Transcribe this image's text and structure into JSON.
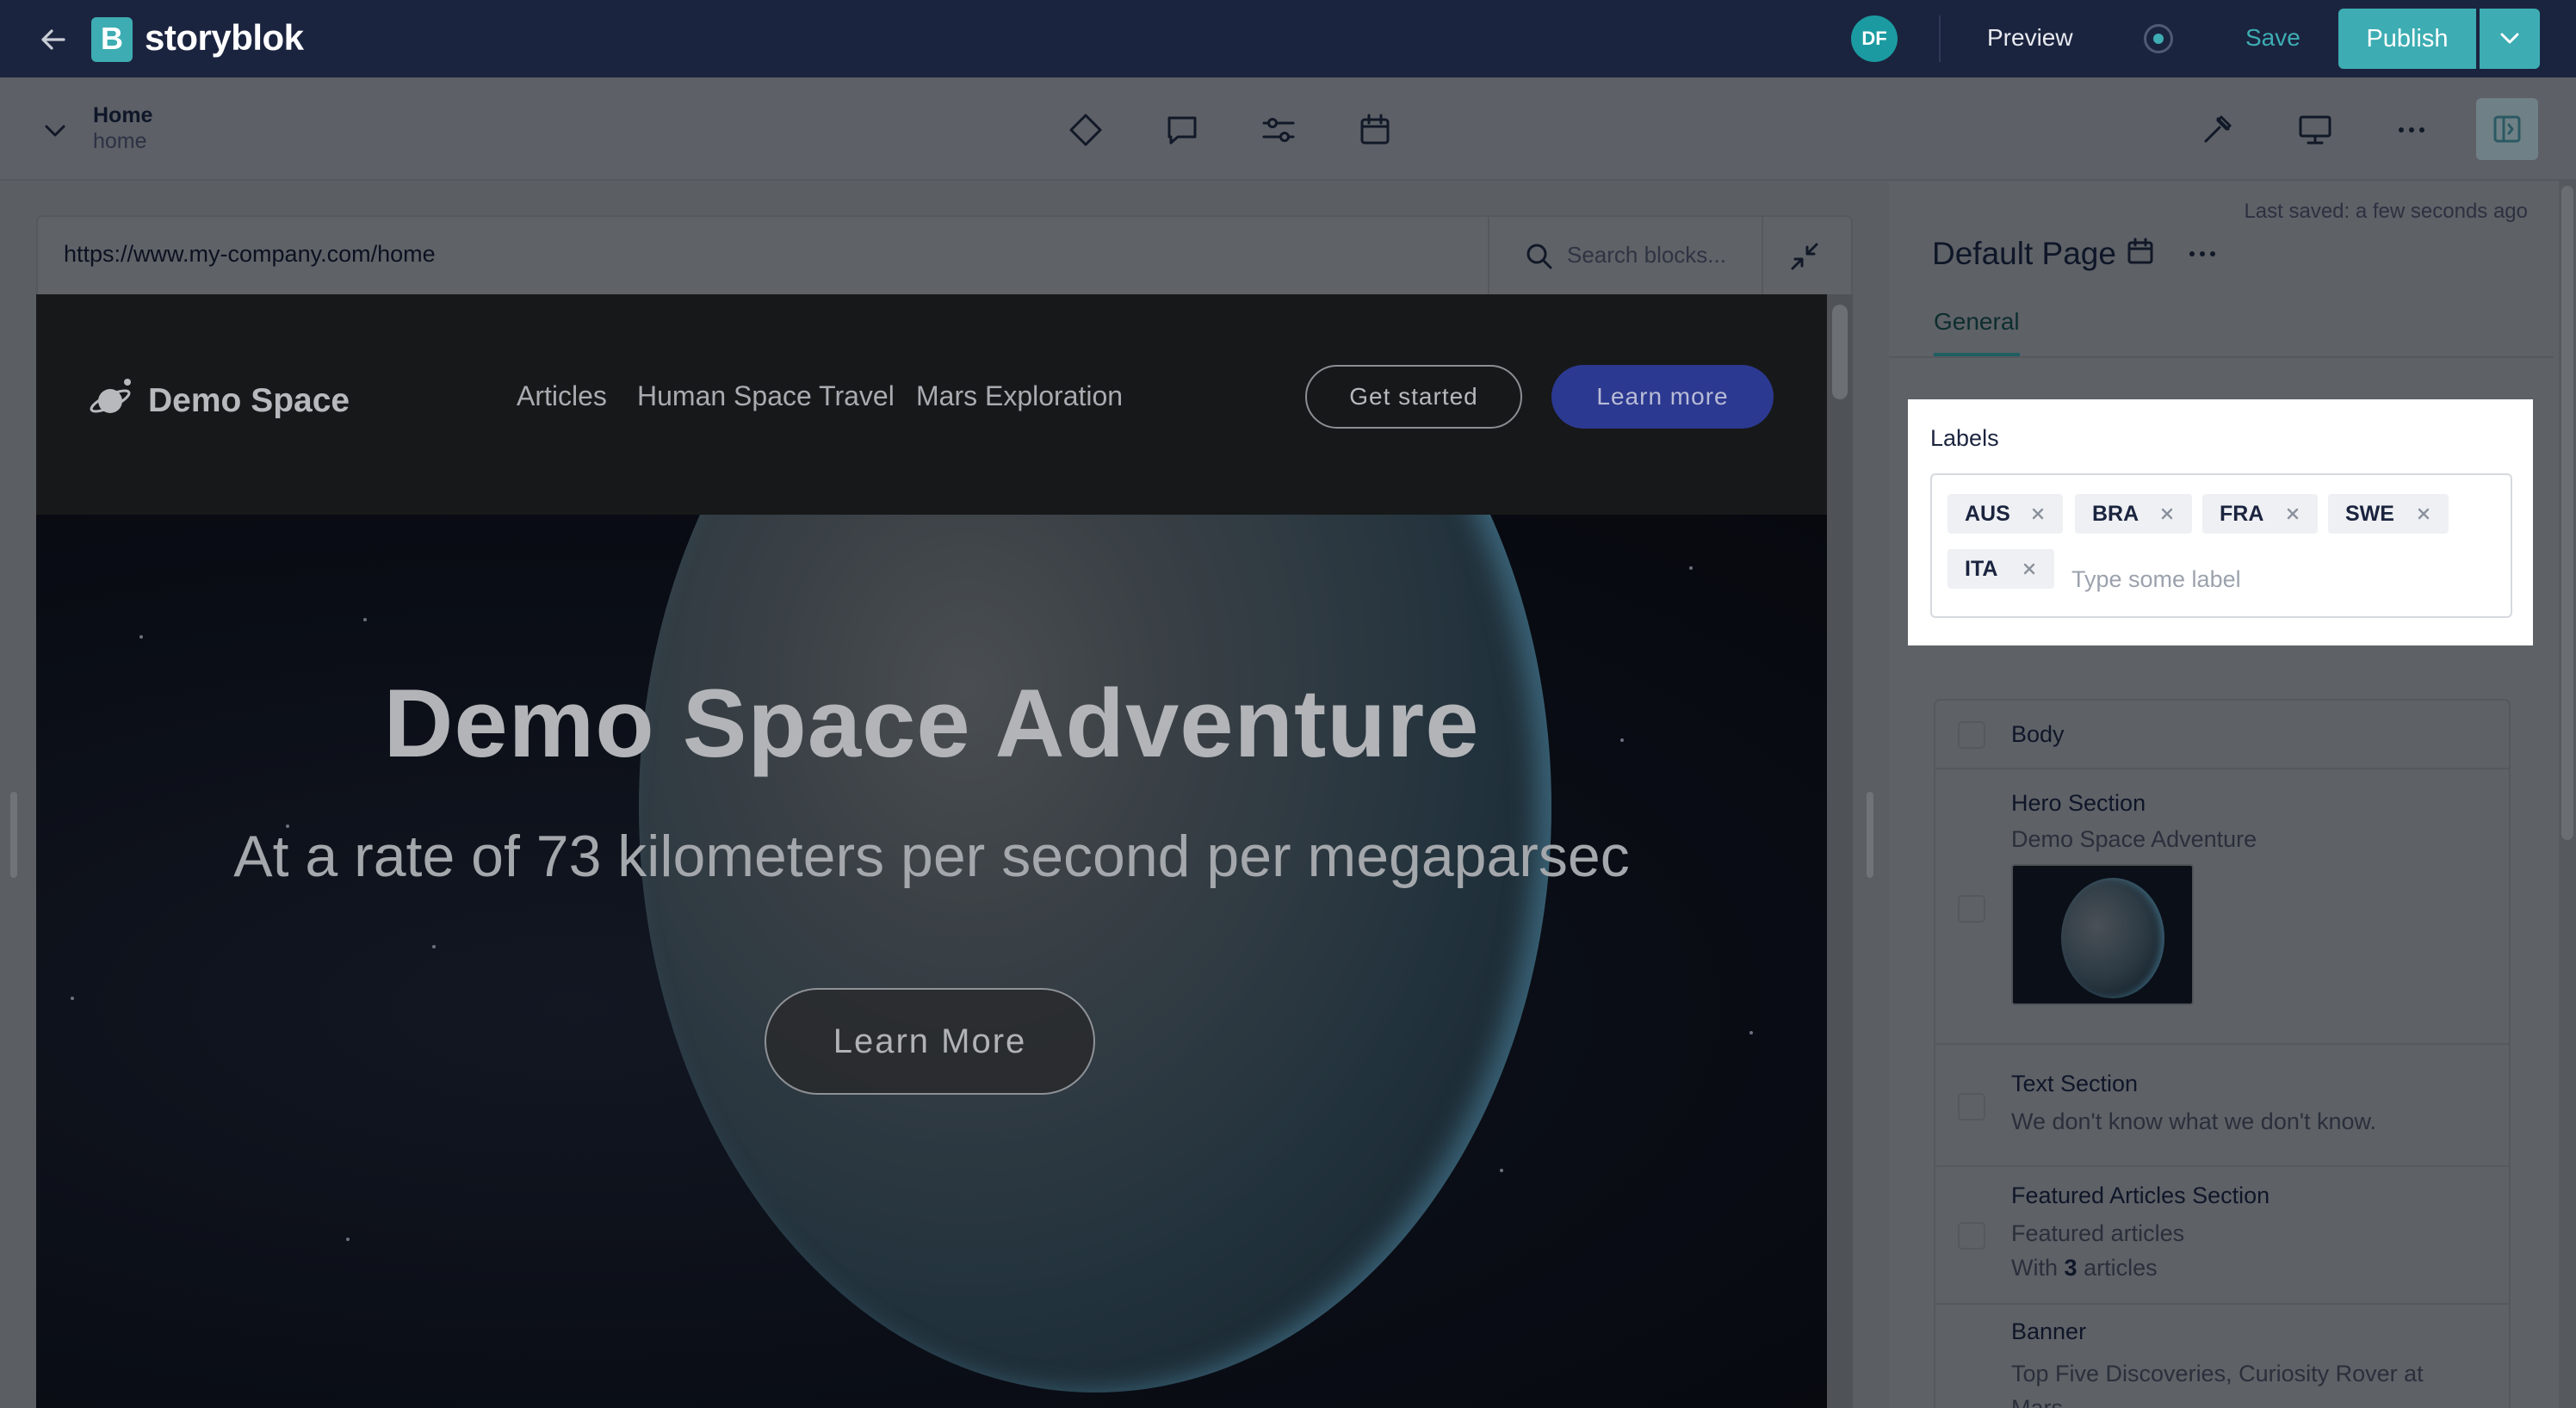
{
  "topbar": {
    "brand": "storyblok",
    "logo_letter": "B",
    "avatar_initials": "DF",
    "preview_label": "Preview",
    "save_label": "Save",
    "publish_label": "Publish"
  },
  "story": {
    "title": "Home",
    "slug": "home"
  },
  "toolbar_icons": [
    "diamond-icon",
    "comment-icon",
    "sliders-icon",
    "calendar-icon",
    "hammer-icon",
    "monitor-icon",
    "more-icon",
    "side-panel-icon"
  ],
  "preview": {
    "url": "https://www.my-company.com/home",
    "search_placeholder": "Search blocks..."
  },
  "site": {
    "logo_text": "Demo Space",
    "nav": [
      "Articles",
      "Human Space Travel",
      "Mars Exploration"
    ],
    "cta_outline": "Get started",
    "cta_primary": "Learn more",
    "hero_title": "Demo Space Adventure",
    "hero_subtitle": "At a rate of 73 kilometers per second per megaparsec",
    "hero_button": "Learn More"
  },
  "panel": {
    "last_saved": "Last saved: a few seconds ago",
    "title": "Default Page",
    "tab": "General",
    "labels_title": "Labels",
    "labels": [
      "AUS",
      "BRA",
      "FRA",
      "SWE",
      "ITA"
    ],
    "labels_placeholder": "Type some label",
    "blocks": {
      "body": "Body",
      "hero_name": "Hero Section",
      "hero_desc": "Demo Space Adventure",
      "text_name": "Text Section",
      "text_desc": "We don't know what we don't know.",
      "featured_name": "Featured Articles Section",
      "featured_desc": "Featured articles",
      "featured_count_prefix": "With",
      "featured_count": "3",
      "featured_count_suffix": "articles",
      "banner_name": "Banner",
      "banner_desc": "Top Five Discoveries, Curiosity Rover at Mars"
    }
  },
  "colors": {
    "brand_teal": "#3dadb3",
    "navy": "#1b243f",
    "site_blue": "#2c3990"
  }
}
